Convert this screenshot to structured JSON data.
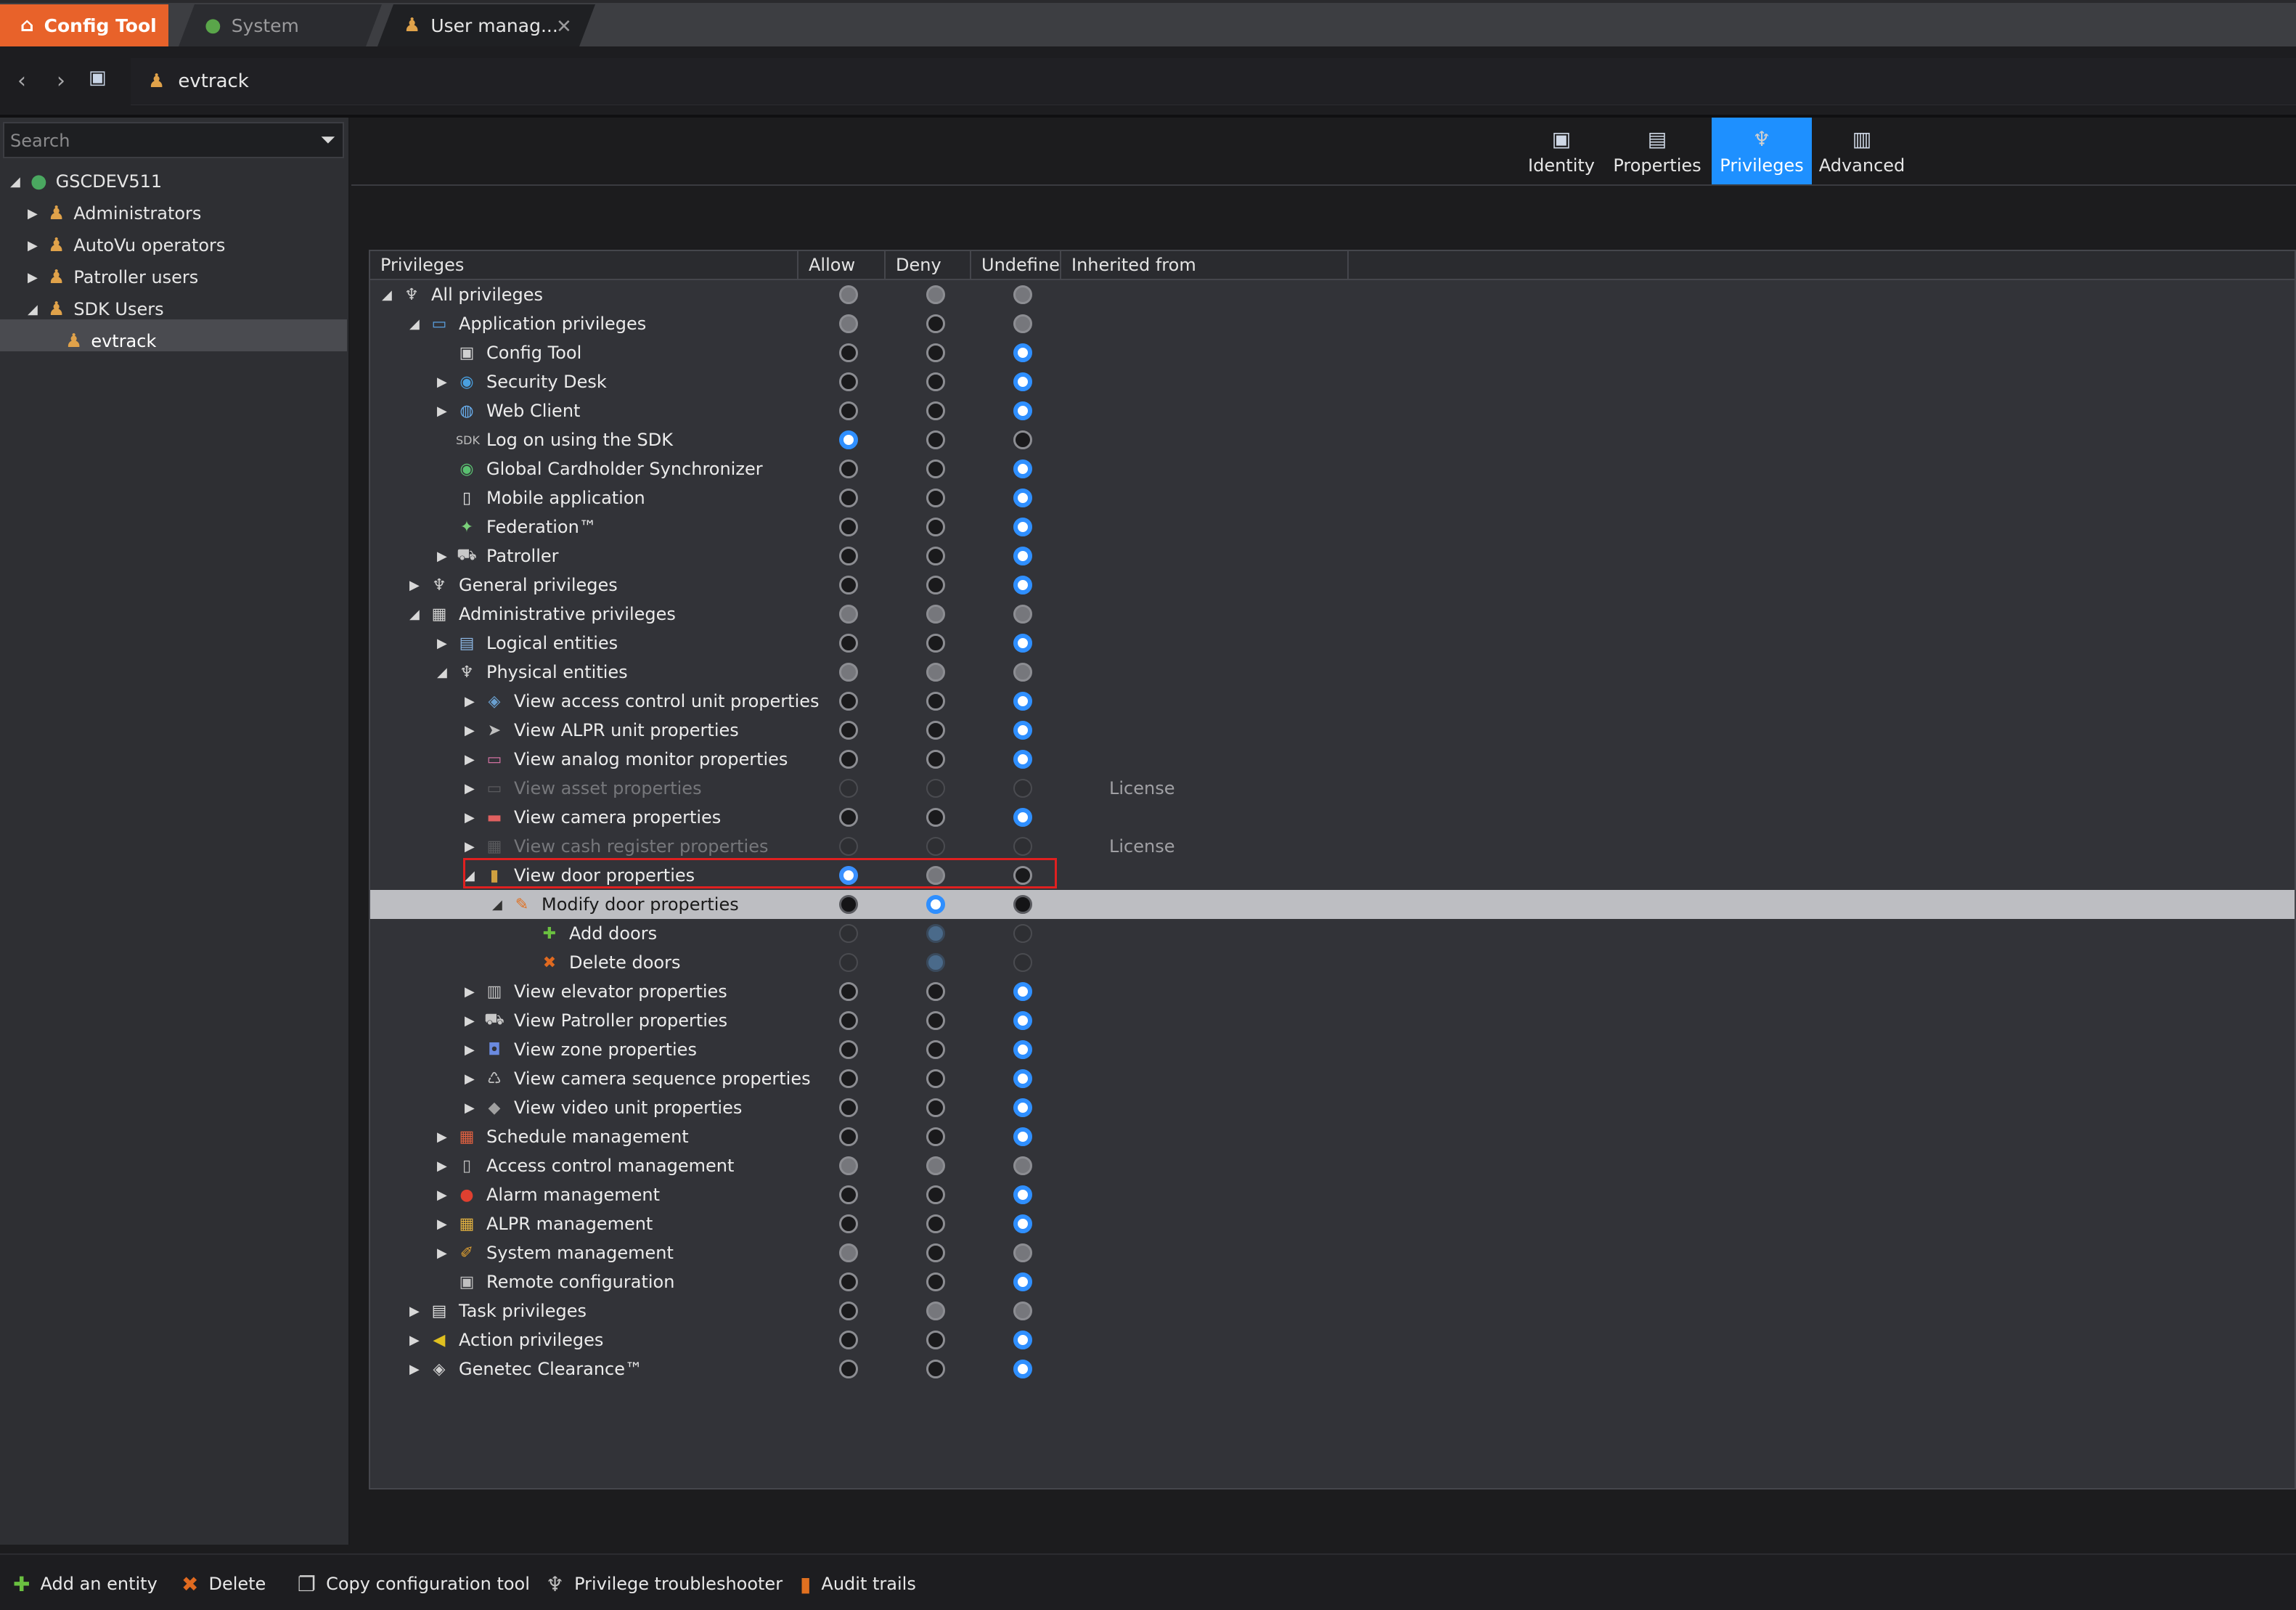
{
  "tabs": {
    "app": "Config Tool",
    "system": "System",
    "user": "User manag..."
  },
  "address": {
    "path": "evtrack"
  },
  "search": {
    "placeholder": "Search"
  },
  "tree": [
    {
      "label": "GSCDEV511",
      "icon": "globe-icon",
      "level": 0,
      "expanded": true
    },
    {
      "label": "Administrators",
      "icon": "user-group-icon",
      "level": 1,
      "expanded": false
    },
    {
      "label": "AutoVu operators",
      "icon": "user-group-icon",
      "level": 1,
      "expanded": false
    },
    {
      "label": "Patroller users",
      "icon": "user-group-icon",
      "level": 1,
      "expanded": false
    },
    {
      "label": "SDK Users",
      "icon": "user-group-icon",
      "level": 1,
      "expanded": true
    },
    {
      "label": "evtrack",
      "icon": "user-icon",
      "level": 2,
      "selected": true
    }
  ],
  "view_tabs": [
    {
      "label": "Identity",
      "icon": "identity-icon",
      "active": false
    },
    {
      "label": "Properties",
      "icon": "properties-icon",
      "active": false
    },
    {
      "label": "Privileges",
      "icon": "privileges-icon",
      "active": true
    },
    {
      "label": "Advanced",
      "icon": "advanced-icon",
      "active": false
    }
  ],
  "grid": {
    "columns": [
      "Privileges",
      "Allow",
      "Deny",
      "Undefine",
      "Inherited from"
    ],
    "rows": [
      {
        "label": "All privileges",
        "level": 0,
        "arrow": "down",
        "icon": "privileges-icon",
        "allow": "gray",
        "deny": "gray",
        "undefine": "gray"
      },
      {
        "label": "Application privileges",
        "level": 1,
        "arrow": "down",
        "icon": "window-icon",
        "allow": "gray",
        "deny": "off",
        "undefine": "gray"
      },
      {
        "label": "Config Tool",
        "level": 2,
        "arrow": "",
        "icon": "config-tool-icon",
        "allow": "off",
        "deny": "off",
        "undefine": "on"
      },
      {
        "label": "Security Desk",
        "level": 2,
        "arrow": "right",
        "icon": "security-desk-icon",
        "allow": "off",
        "deny": "off",
        "undefine": "on"
      },
      {
        "label": "Web Client",
        "level": 2,
        "arrow": "right",
        "icon": "web-client-icon",
        "allow": "off",
        "deny": "off",
        "undefine": "on"
      },
      {
        "label": "Log on using the SDK",
        "level": 2,
        "arrow": "",
        "icon": "sdk-icon",
        "icon_text": "SDK",
        "allow": "on",
        "deny": "off",
        "undefine": "off"
      },
      {
        "label": "Global Cardholder Synchronizer",
        "level": 2,
        "arrow": "",
        "icon": "sync-icon",
        "allow": "off",
        "deny": "off",
        "undefine": "on"
      },
      {
        "label": "Mobile application",
        "level": 2,
        "arrow": "",
        "icon": "mobile-icon",
        "allow": "off",
        "deny": "off",
        "undefine": "on"
      },
      {
        "label": "Federation™",
        "level": 2,
        "arrow": "",
        "icon": "federation-icon",
        "allow": "off",
        "deny": "off",
        "undefine": "on"
      },
      {
        "label": "Patroller",
        "level": 2,
        "arrow": "right",
        "icon": "patroller-icon",
        "allow": "off",
        "deny": "off",
        "undefine": "on"
      },
      {
        "label": "General privileges",
        "level": 1,
        "arrow": "right",
        "icon": "privileges-icon",
        "allow": "off",
        "deny": "off",
        "undefine": "on"
      },
      {
        "label": "Administrative privileges",
        "level": 1,
        "arrow": "down",
        "icon": "admin-icon",
        "allow": "gray",
        "deny": "gray",
        "undefine": "gray"
      },
      {
        "label": "Logical entities",
        "level": 2,
        "arrow": "right",
        "icon": "logical-entities-icon",
        "allow": "off",
        "deny": "off",
        "undefine": "on"
      },
      {
        "label": "Physical entities",
        "level": 2,
        "arrow": "down",
        "icon": "privileges-icon",
        "allow": "gray",
        "deny": "gray",
        "undefine": "gray"
      },
      {
        "label": "View access control unit properties",
        "level": 3,
        "arrow": "right",
        "icon": "access-unit-icon",
        "allow": "off",
        "deny": "off",
        "undefine": "on"
      },
      {
        "label": "View ALPR unit properties",
        "level": 3,
        "arrow": "right",
        "icon": "alpr-unit-icon",
        "allow": "off",
        "deny": "off",
        "undefine": "on"
      },
      {
        "label": "View analog monitor properties",
        "level": 3,
        "arrow": "right",
        "icon": "monitor-icon",
        "allow": "off",
        "deny": "off",
        "undefine": "on"
      },
      {
        "label": "View asset properties",
        "level": 3,
        "arrow": "right",
        "icon": "asset-icon",
        "allow": "faint",
        "deny": "faint",
        "undefine": "faint",
        "dim": true,
        "inherited": "License"
      },
      {
        "label": "View camera properties",
        "level": 3,
        "arrow": "right",
        "icon": "camera-icon",
        "allow": "off",
        "deny": "off",
        "undefine": "on"
      },
      {
        "label": "View cash register properties",
        "level": 3,
        "arrow": "right",
        "icon": "cash-register-icon",
        "allow": "faint",
        "deny": "faint",
        "undefine": "faint",
        "dim": true,
        "inherited": "License"
      },
      {
        "label": "View door properties",
        "level": 3,
        "arrow": "down",
        "icon": "door-icon",
        "allow": "allowon",
        "deny": "gray",
        "undefine": "off",
        "highlighted": true
      },
      {
        "label": "Modify door properties",
        "level": 4,
        "arrow": "down",
        "icon": "pencil-icon",
        "allow": "dark",
        "deny": "on",
        "undefine": "dark",
        "selected": true
      },
      {
        "label": "Add doors",
        "level": 5,
        "arrow": "",
        "icon": "plus-icon",
        "allow": "faint",
        "deny": "faintblue",
        "undefine": "faint"
      },
      {
        "label": "Delete doors",
        "level": 5,
        "arrow": "",
        "icon": "delete-icon",
        "allow": "faint",
        "deny": "faintblue",
        "undefine": "faint"
      },
      {
        "label": "View elevator properties",
        "level": 3,
        "arrow": "right",
        "icon": "elevator-icon",
        "allow": "off",
        "deny": "off",
        "undefine": "on"
      },
      {
        "label": "View Patroller properties",
        "level": 3,
        "arrow": "right",
        "icon": "patroller-icon",
        "allow": "off",
        "deny": "off",
        "undefine": "on"
      },
      {
        "label": "View zone properties",
        "level": 3,
        "arrow": "right",
        "icon": "zone-icon",
        "allow": "off",
        "deny": "off",
        "undefine": "on"
      },
      {
        "label": "View camera sequence properties",
        "level": 3,
        "arrow": "right",
        "icon": "camera-sequence-icon",
        "allow": "off",
        "deny": "off",
        "undefine": "on"
      },
      {
        "label": "View video unit properties",
        "level": 3,
        "arrow": "right",
        "icon": "video-unit-icon",
        "allow": "off",
        "deny": "off",
        "undefine": "on"
      },
      {
        "label": "Schedule management",
        "level": 2,
        "arrow": "right",
        "icon": "schedule-icon",
        "allow": "off",
        "deny": "off",
        "undefine": "on"
      },
      {
        "label": "Access control management",
        "level": 2,
        "arrow": "right",
        "icon": "access-control-icon",
        "allow": "gray",
        "deny": "gray",
        "undefine": "gray"
      },
      {
        "label": "Alarm management",
        "level": 2,
        "arrow": "right",
        "icon": "alarm-icon",
        "allow": "off",
        "deny": "off",
        "undefine": "on"
      },
      {
        "label": "ALPR management",
        "level": 2,
        "arrow": "right",
        "icon": "alpr-icon",
        "allow": "off",
        "deny": "off",
        "undefine": "on"
      },
      {
        "label": "System management",
        "level": 2,
        "arrow": "right",
        "icon": "system-icon",
        "allow": "gray",
        "deny": "off",
        "undefine": "gray"
      },
      {
        "label": "Remote configuration",
        "level": 2,
        "arrow": "",
        "icon": "remote-config-icon",
        "allow": "off",
        "deny": "off",
        "undefine": "on"
      },
      {
        "label": "Task privileges",
        "level": 1,
        "arrow": "right",
        "icon": "task-icon",
        "allow": "off",
        "deny": "gray",
        "undefine": "gray"
      },
      {
        "label": "Action privileges",
        "level": 1,
        "arrow": "right",
        "icon": "action-icon",
        "allow": "off",
        "deny": "off",
        "undefine": "on"
      },
      {
        "label": "Genetec Clearance™",
        "level": 1,
        "arrow": "right",
        "icon": "clearance-icon",
        "allow": "off",
        "deny": "off",
        "undefine": "on"
      }
    ]
  },
  "bottom_toolbar": [
    {
      "label": "Add an entity",
      "icon": "plus-icon"
    },
    {
      "label": "Delete",
      "icon": "delete-icon"
    },
    {
      "label": "Copy configuration tool",
      "icon": "copy-icon"
    },
    {
      "label": "Privilege troubleshooter",
      "icon": "troubleshooter-icon"
    },
    {
      "label": "Audit trails",
      "icon": "audit-icon"
    }
  ],
  "colors": {
    "accent_orange": "#e8622a",
    "active_tab_blue": "#1e90ff",
    "radio_on_blue": "#2f8fff",
    "highlight_red": "#e02020",
    "selected_row": "#bdbec2"
  }
}
